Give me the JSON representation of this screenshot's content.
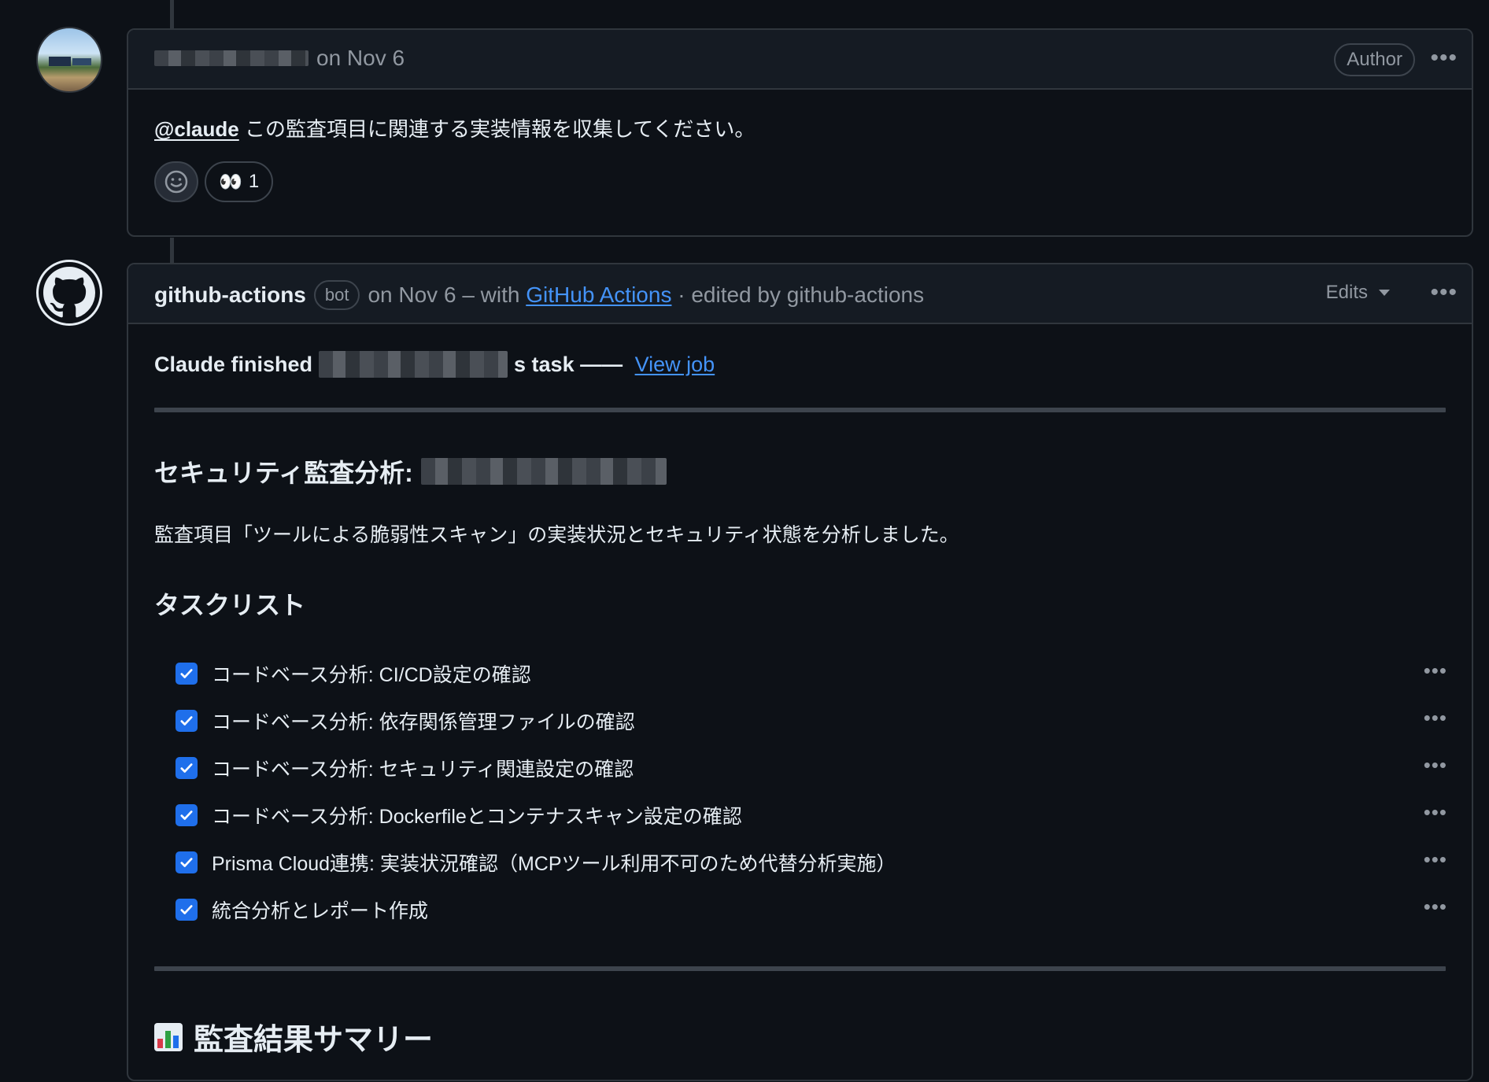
{
  "comments": [
    {
      "username_redacted": true,
      "date_text": "on Nov 6",
      "author_badge": "Author",
      "mention": "@claude",
      "body": " この監査項目に関連する実装情報を収集してください。",
      "reactions": [
        {
          "emoji": "👀",
          "count": "1"
        }
      ]
    },
    {
      "bot_name": "github-actions",
      "bot_badge": "bot",
      "meta_pre": "on Nov 6 – with ",
      "meta_link": "GitHub Actions",
      "meta_post": " · edited by github-actions",
      "edits_label": "Edits",
      "claude_pre": "Claude finished",
      "claude_post": "s task —— ",
      "view_job": "View job",
      "heading": "セキュリティ監査分析:",
      "intro": "監査項目「ツールによる脆弱性スキャン」の実装状況とセキュリティ状態を分析しました。",
      "tasklist_heading": "タスクリスト",
      "tasks": [
        "コードベース分析: CI/CD設定の確認",
        "コードベース分析: 依存関係管理ファイルの確認",
        "コードベース分析: セキュリティ関連設定の確認",
        "コードベース分析: Dockerfileとコンテナスキャン設定の確認",
        "Prisma Cloud連携: 実装状況確認（MCPツール利用不可のため代替分析実施）",
        "統合分析とレポート作成"
      ],
      "summary_heading": "監査結果サマリー"
    }
  ],
  "icons": {
    "avatar_user": "baseball-stadium-avatar",
    "avatar_bot": "github-octocat-icon",
    "smiley": "smiley-icon",
    "kebab": "kebab-horizontal-icon",
    "chart": "bar-chart-icon"
  },
  "colors": {
    "background": "#0d1117",
    "header": "#151b23",
    "border": "#30363d",
    "link": "#4493f8",
    "checkbox": "#1f6feb",
    "muted_text": "#9198a1"
  }
}
